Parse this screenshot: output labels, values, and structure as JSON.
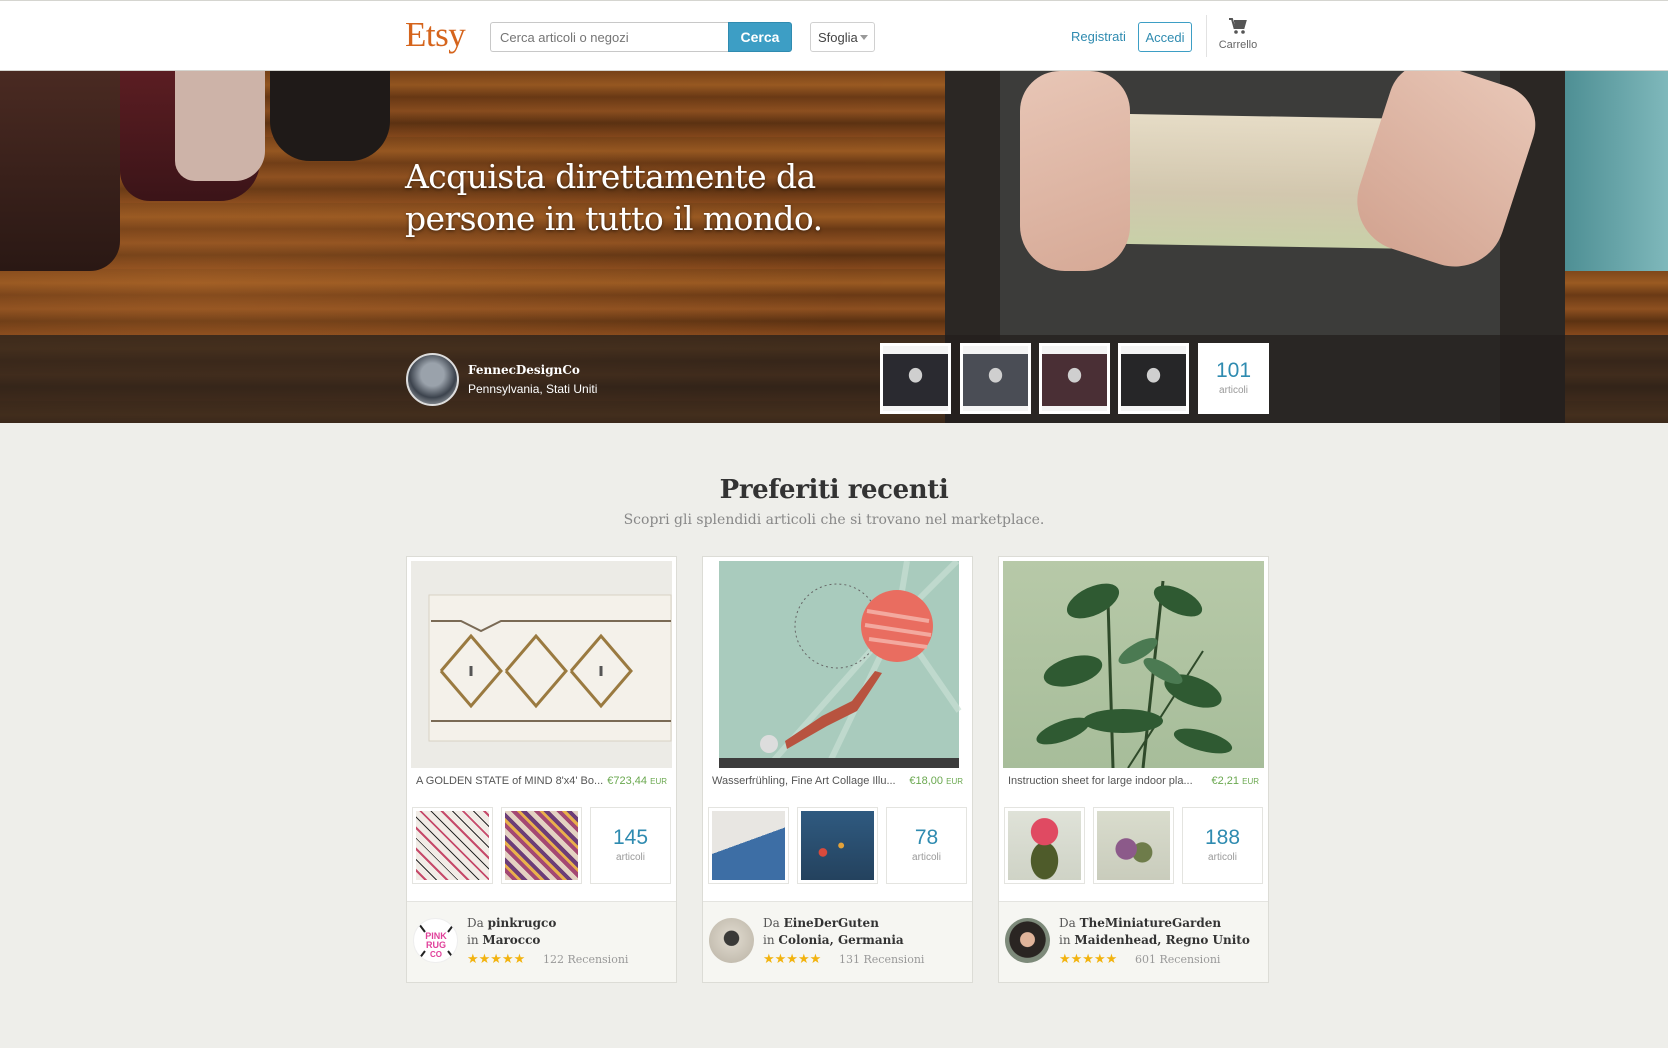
{
  "header": {
    "logo": "Etsy",
    "search_placeholder": "Cerca articoli o negozi",
    "search_button": "Cerca",
    "browse_label": "Sfoglia",
    "register_label": "Registrati",
    "login_label": "Accedi",
    "cart_label": "Carrello"
  },
  "hero": {
    "headline_line1": "Acquista direttamente da",
    "headline_line2": "persone in tutto il mondo.",
    "seller_name": "FennecDesignCo",
    "seller_location": "Pennsylvania, Stati Uniti",
    "item_count": "101",
    "item_count_label": "articoli",
    "thumb_colors": [
      "#2a2a30",
      "#4a4d55",
      "#4a2f35",
      "#262628"
    ]
  },
  "section": {
    "title": "Preferiti recenti",
    "subtitle": "Scopri gli splendidi articoli che si trovano nel marketplace."
  },
  "cards": [
    {
      "item_title": "A GOLDEN STATE of MIND 8'x4' Bo...",
      "price": "€723,44",
      "currency": "EUR",
      "count": "145",
      "count_label": "articoli",
      "by_prefix": "Da",
      "shop": "pinkrugco",
      "in_prefix": "in",
      "location": "Marocco",
      "stars": "★★★★★",
      "reviews": "122 Recensioni"
    },
    {
      "item_title": "Wasserfrühling, Fine Art Collage Illu...",
      "price": "€18,00",
      "currency": "EUR",
      "count": "78",
      "count_label": "articoli",
      "by_prefix": "Da",
      "shop": "EineDerGuten",
      "in_prefix": "in",
      "location": "Colonia, Germania",
      "stars": "★★★★★",
      "reviews": "131 Recensioni"
    },
    {
      "item_title": "Instruction sheet for large indoor pla...",
      "price": "€2,21",
      "currency": "EUR",
      "count": "188",
      "count_label": "articoli",
      "by_prefix": "Da",
      "shop": "TheMiniatureGarden",
      "in_prefix": "in",
      "location": "Maidenhead, Regno Unito",
      "stars": "★★★★★",
      "reviews": "601 Recensioni"
    }
  ],
  "colors": {
    "brand": "#d5641c",
    "accent": "#3d9ec5",
    "price": "#6aa84f",
    "star": "#f2b30f",
    "page_bg": "#eeeeea"
  }
}
